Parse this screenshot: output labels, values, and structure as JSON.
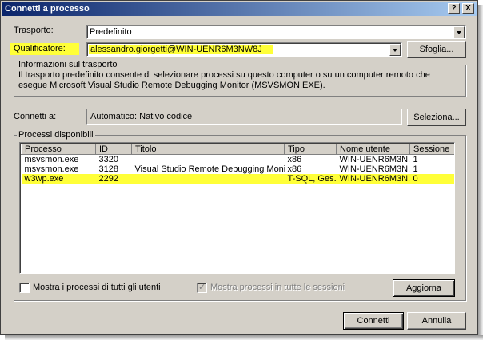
{
  "window": {
    "title": "Connetti a processo",
    "help_glyph": "?",
    "close_glyph": "X"
  },
  "transport": {
    "label": "Trasporto:",
    "value": "Predefinito"
  },
  "qualifier": {
    "label": "Qualificatore:",
    "value": "alessandro.giorgetti@WIN-UENR6M3NW8J",
    "browse_label": "Sfoglia..."
  },
  "transport_info": {
    "title": "Informazioni sul trasporto",
    "text": "Il trasporto predefinito consente di selezionare processi su questo computer o su un computer remoto che esegue Microsoft Visual Studio Remote Debugging Monitor (MSVSMON.EXE)."
  },
  "connect_to": {
    "label": "Connetti a:",
    "value": "Automatico: Nativo codice",
    "select_label": "Seleziona..."
  },
  "processes": {
    "title": "Processi disponibili",
    "columns": [
      "Processo",
      "ID",
      "Titolo",
      "Tipo",
      "Nome utente",
      "Sessione"
    ],
    "rows": [
      {
        "process": "msvsmon.exe",
        "id": "3320",
        "title": "",
        "type": "x86",
        "user": "WIN-UENR6M3N...",
        "session": "1",
        "highlighted": false
      },
      {
        "process": "msvsmon.exe",
        "id": "3128",
        "title": "Visual Studio Remote Debugging Monitor (...",
        "type": "x86",
        "user": "WIN-UENR6M3N...",
        "session": "1",
        "highlighted": false
      },
      {
        "process": "w3wp.exe",
        "id": "2292",
        "title": "",
        "type": "T-SQL, Ges...",
        "user": "WIN-UENR6M3N...",
        "session": "0",
        "highlighted": true
      }
    ],
    "show_all_users_label": "Mostra i processi di tutti gli utenti",
    "show_all_sessions_label": "Mostra processi in tutte le sessioni",
    "refresh_label": "Aggiorna"
  },
  "buttons": {
    "connect_label": "Connetti",
    "cancel_label": "Annulla"
  },
  "colors": {
    "highlight": "#ffff38",
    "titlebar_start": "#0a246a",
    "titlebar_end": "#a6caf0",
    "face": "#d4d0c8"
  }
}
